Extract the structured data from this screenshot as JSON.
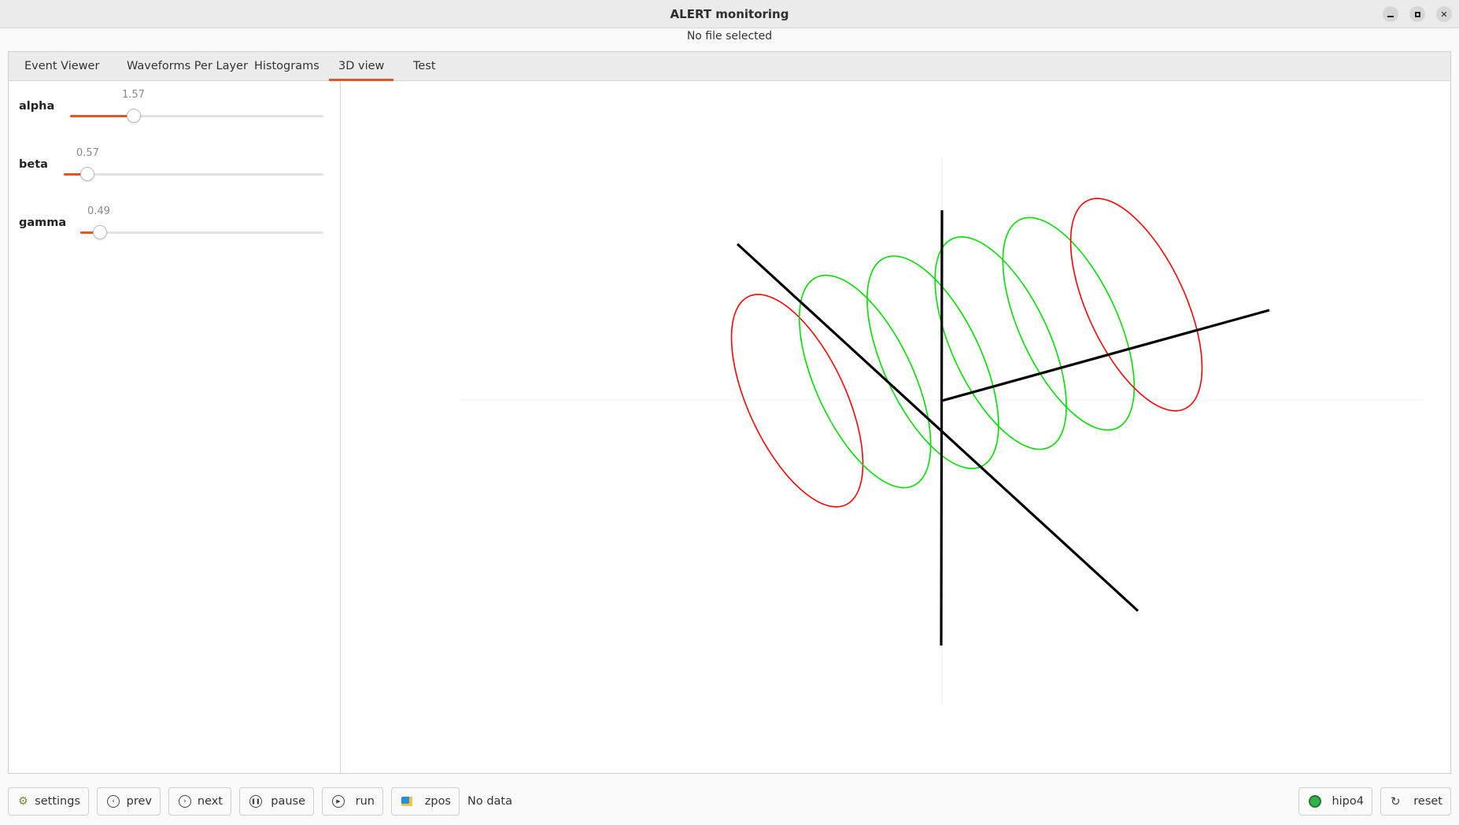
{
  "window": {
    "title": "ALERT monitoring",
    "file_status": "No file selected"
  },
  "tabs": [
    {
      "label": "Event Viewer",
      "active": false
    },
    {
      "label": "Waveforms Per Layer",
      "active": false
    },
    {
      "label": "Histograms",
      "active": false
    },
    {
      "label": "3D view",
      "active": true
    },
    {
      "label": "Test",
      "active": false
    }
  ],
  "controls": {
    "sliders": [
      {
        "name": "alpha",
        "value": "1.57",
        "fraction": 0.25
      },
      {
        "name": "beta",
        "value": "0.57",
        "fraction": 0.09
      },
      {
        "name": "gamma",
        "value": "0.49",
        "fraction": 0.08
      }
    ]
  },
  "view3d": {
    "axis_color": "#000000",
    "endcap_ring_color": "#ff0000",
    "inner_ring_color": "#00e000",
    "ring_count": 6
  },
  "toolbar": {
    "settings_label": "settings",
    "prev_label": "prev",
    "next_label": "next",
    "pause_label": "pause",
    "run_label": "run",
    "zpos_label": "zpos",
    "data_status": "No data",
    "hipo_label": "hipo4",
    "reset_label": "reset"
  },
  "colors": {
    "accent": "#e95420"
  }
}
